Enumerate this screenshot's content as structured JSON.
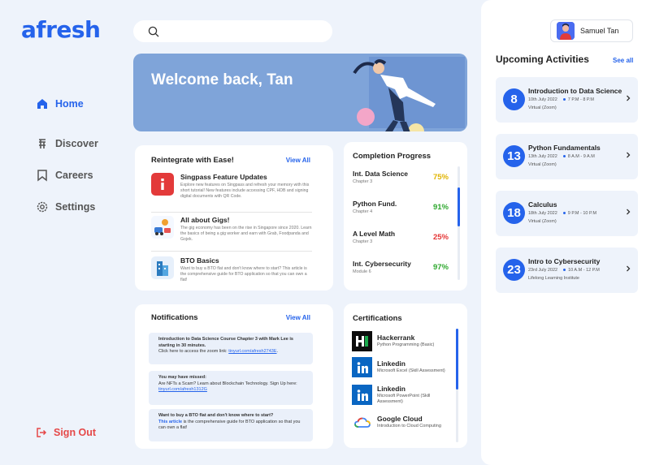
{
  "brand": {
    "logo": "afresh",
    "accent": "#2563eb"
  },
  "search": {
    "placeholder": ""
  },
  "nav": {
    "items": [
      {
        "label": "Home",
        "icon": "home-icon",
        "active": true
      },
      {
        "label": "Discover",
        "icon": "discover-icon"
      },
      {
        "label": "Careers",
        "icon": "bookmark-icon"
      },
      {
        "label": "Settings",
        "icon": "gear-icon"
      }
    ],
    "signout": "Sign Out"
  },
  "banner": {
    "title": "Welcome back, Tan"
  },
  "reintegrate": {
    "title": "Reintegrate with Ease!",
    "view_all": "View All",
    "articles": [
      {
        "title": "Singpass Feature Updates",
        "desc": "Explore new features on Singpass and refresh your memory with this short tutorial! New features include accessing CPF, HDB and signing digital documents with QR Code."
      },
      {
        "title": "All about Gigs!",
        "desc": "The gig economy has been on the rise in Singapore since 2020. Learn the basics of being a gig worker and earn with Grab, Foodpanda and Gojek."
      },
      {
        "title": "BTO Basics",
        "desc": "Want to buy a BTO flat and don't know where to start? This article is the comprehensive guide for BTO application so that you can own a flat!"
      }
    ]
  },
  "progress": {
    "title": "Completion Progress",
    "items": [
      {
        "name": "Int. Data Science",
        "chapter": "Chapter 3",
        "percent": "75%",
        "color": "#e0b400"
      },
      {
        "name": "Python Fund.",
        "chapter": "Chapter 4",
        "percent": "91%",
        "color": "#2ea82e"
      },
      {
        "name": "A Level Math",
        "chapter": "Chapter 3",
        "percent": "25%",
        "color": "#e53535"
      },
      {
        "name": "Int. Cybersecurity",
        "chapter": "Module 6",
        "percent": "97%",
        "color": "#2ea82e"
      }
    ]
  },
  "notifications": {
    "title": "Notifications",
    "view_all": "View All",
    "items": [
      {
        "bold": "Introduction to Data Science Course Chapter 3 with Mark Lee is starting in 30 minutes.",
        "text": "Click here to access the zoom link: ",
        "link": "tinyurl.com/afresh2743E",
        "tail": "."
      },
      {
        "bold": "You may have missed:",
        "text": "Are NFTs a Scam? Learn about Blockchain Technology. Sign Up here:",
        "link": "tinyurl.com/afresh1312G"
      },
      {
        "bold": "Want to buy a BTO flat and don't know where to start?",
        "link": "This article",
        "text": " is the comprehensive guide for BTO application so that you can own a flat!"
      }
    ]
  },
  "certifications": {
    "title": "Certifications",
    "items": [
      {
        "name": "Hackerrank",
        "sub": "Python Programming (Basic)",
        "icon": "hackerrank-icon"
      },
      {
        "name": "Linkedin",
        "sub": "Microsoft Excel (Skill Assessment)",
        "icon": "linkedin-icon"
      },
      {
        "name": "Linkedin",
        "sub": "Microsoft PowerPoint (Skill Assessment)",
        "icon": "linkedin-icon"
      },
      {
        "name": "Google Cloud",
        "sub": "Introduction to Cloud Computing",
        "icon": "google-cloud-icon"
      }
    ]
  },
  "user": {
    "name": "Samuel Tan"
  },
  "upcoming": {
    "title": "Upcoming Activities",
    "see_all": "See all",
    "items": [
      {
        "day": "8",
        "title": "Introduction to Data Science",
        "date": "10th July 2022",
        "time": "7 P.M - 8 P.M",
        "location": "Virtual (Zoom)"
      },
      {
        "day": "13",
        "title": "Python Fundamentals",
        "date": "13th July 2022",
        "time": "8 A.M - 9 A.M",
        "location": "Virtual (Zoom)"
      },
      {
        "day": "18",
        "title": "Calculus",
        "date": "18th July 2022",
        "time": "9 P.M - 10 P.M",
        "location": "Virtual (Zoom)"
      },
      {
        "day": "23",
        "title": "Intro to Cybersecurity",
        "date": "23rd July 2022",
        "time": "10 A.M - 12 P.M",
        "location": "Lifelong Learning Institute"
      }
    ]
  }
}
